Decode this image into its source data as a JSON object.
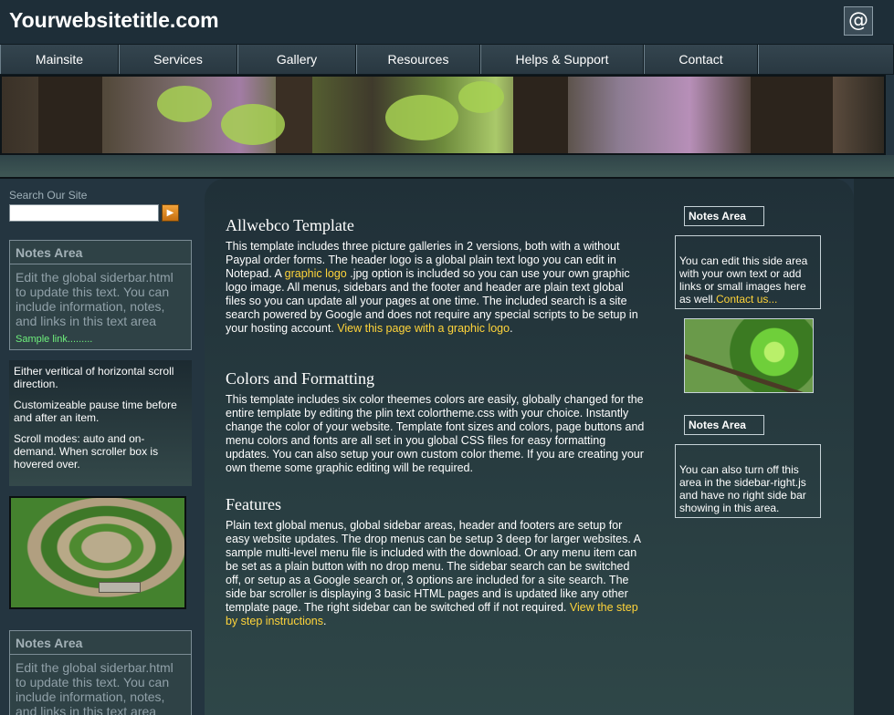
{
  "header": {
    "site_title": "Yourwebsitetitle.com",
    "email_icon_glyph": "@"
  },
  "nav": {
    "items": [
      "Mainsite",
      "Services",
      "Gallery",
      "Resources",
      "Helps & Support",
      "Contact"
    ]
  },
  "left_sidebar": {
    "search_label": "Search Our Site",
    "search_value": "",
    "search_button_glyph": "▶",
    "notes_top": {
      "title": "Notes Area",
      "body": "Edit the global siderbar.html to update this text. You can include information, notes, and links in this text area",
      "link": "Sample link........."
    },
    "scroller": [
      "Either veritical of horizontal scroll direction.",
      "Customizeable pause time before and after an item.",
      "Scroll modes: auto and on-demand. When scroller box is hovered over."
    ],
    "notes_bottom": {
      "title": "Notes Area",
      "body": "Edit the global siderbar.html to update this text. You can include information, notes, and links in this text area"
    }
  },
  "main": {
    "sections": [
      {
        "title": "Allwebco Template",
        "t1": "This template includes three picture galleries in 2 versions, both with a without Paypal order forms. The header logo is a global plain text logo you can edit in Notepad. A ",
        "link1": "graphic logo",
        "t2": " .jpg option is included so you can use your own graphic logo image. All menus, sidebars and the footer and header are plain text global files so you can update all your pages at one time. The included search is a site search powered by Google and does not require any special scripts to be setup in your hosting account. ",
        "link2": "View this page with a graphic logo",
        "t3": "."
      },
      {
        "title": "Colors and Formatting",
        "t1": "This template includes six color theemes colors are easily, globally changed for the entire template by editing the plin text colortheme.css with your choice. Instantly change the color of your website. Template font sizes and colors, page buttons and menu colors and fonts are all set in you global CSS files for easy formatting updates. You can also setup your own custom color theme. If you are creating your own theme some graphic editing will be required."
      },
      {
        "title": "Features",
        "t1": "Plain text global menus, global sidebar areas, header and footers are setup for easy website updates. The drop menus can be setup 3 deep for larger websites. A sample multi-level menu file is included with the download. Or any menu item can be set as a plain button with no drop menu. The sidebar search can be switched off, or setup as a Google search or, 3 options are included for a site search. The side bar scroller is displaying 3 basic HTML pages and is updated like any other template page. The right sidebar can be switched off if not required. ",
        "link1": "View the step by step instructions",
        "t2": "."
      }
    ]
  },
  "right_sidebar": {
    "box1": {
      "title": "Notes Area",
      "text": "You can edit this side area with your own text or add links or small images here as well.",
      "link": "Contact us..."
    },
    "box2": {
      "title": "Notes Area",
      "text": "You can also turn off this area in the sidebar-right.js and have no right side bar showing in this area."
    }
  },
  "colors": {
    "page_bg": "#243540",
    "link_yellow": "#ffd43a",
    "sample_link_green": "#6ef07c",
    "search_button_orange": "#e08a20"
  }
}
